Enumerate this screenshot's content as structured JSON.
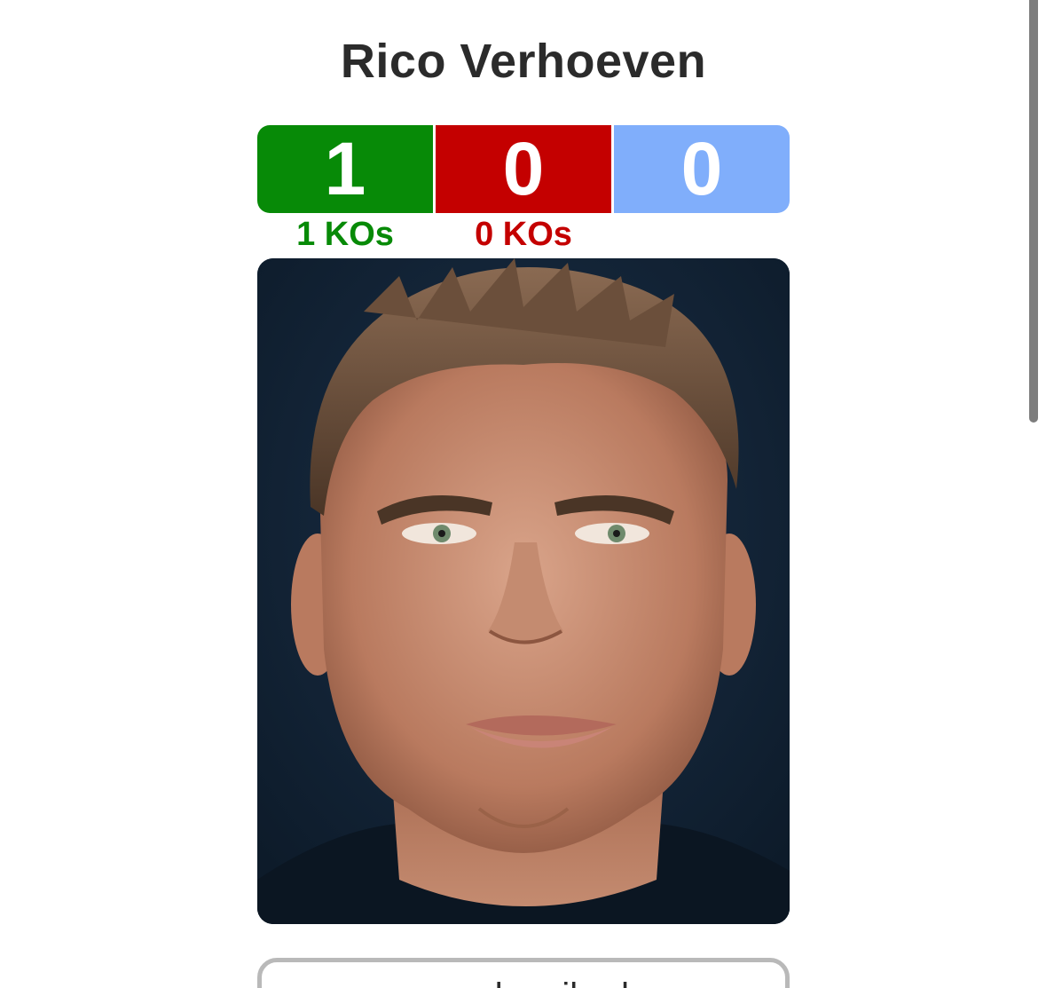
{
  "fighter": {
    "name": "Rico Verhoeven"
  },
  "record": {
    "wins": "1",
    "losses": "0",
    "draws": "0",
    "wins_ko": "1 KOs",
    "losses_ko": "0 KOs"
  },
  "colors": {
    "wins": "#078a07",
    "losses": "#c40000",
    "draws": "#80aefb",
    "text": "#2b2b2b"
  },
  "subscribe": {
    "label": "unsubscribed"
  },
  "icons": {
    "photo": "fighter-portrait"
  }
}
